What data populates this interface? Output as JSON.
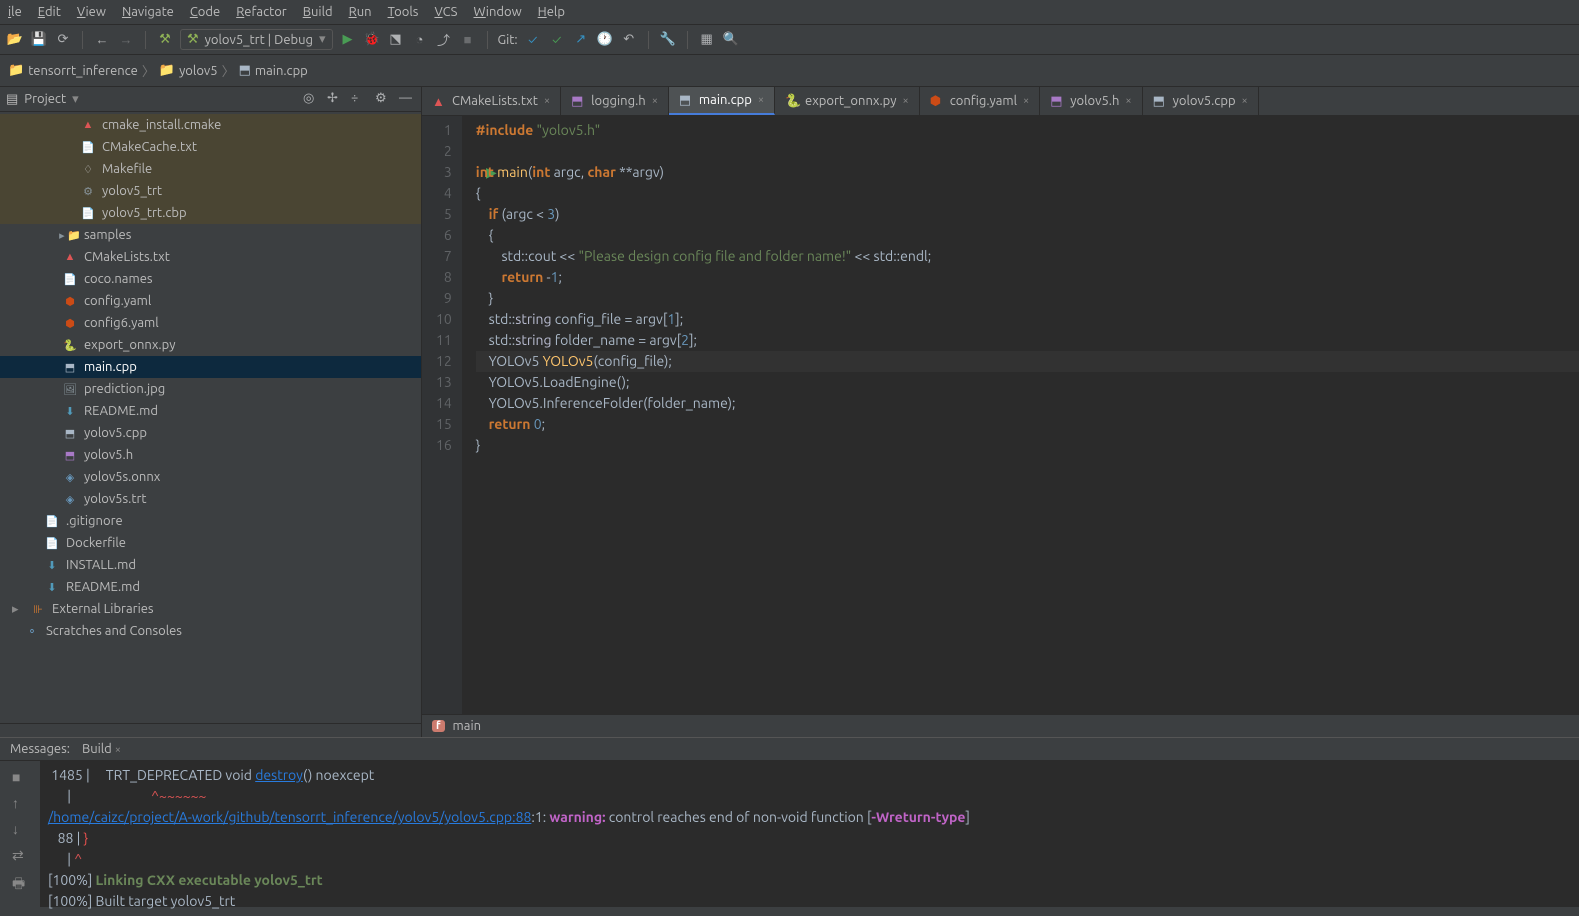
{
  "menu": [
    "ile",
    "Edit",
    "View",
    "Navigate",
    "Code",
    "Refactor",
    "Build",
    "Run",
    "Tools",
    "VCS",
    "Window",
    "Help"
  ],
  "toolbar": {
    "run_config": "yolov5_trt | Debug",
    "git_label": "Git:"
  },
  "breadcrumb": {
    "root": "tensorrt_inference",
    "folder": "yolov5",
    "file": "main.cpp"
  },
  "project": {
    "label": "Project",
    "items": [
      {
        "name": "cmake_install.cmake",
        "cls": "fi-cmake",
        "icon": "▲",
        "i": 3,
        "hl": true
      },
      {
        "name": "CMakeCache.txt",
        "cls": "fi-txt",
        "icon": "📄",
        "i": 3,
        "hl": true
      },
      {
        "name": "Makefile",
        "cls": "fi-make",
        "icon": "♢",
        "i": 3,
        "hl": true
      },
      {
        "name": "yolov5_trt",
        "cls": "fi-txt",
        "icon": "⚙",
        "i": 3,
        "hl": true
      },
      {
        "name": "yolov5_trt.cbp",
        "cls": "fi-txt",
        "icon": "📄",
        "i": 3,
        "hl": true
      },
      {
        "name": "samples",
        "cls": "fi-folder",
        "icon": "▸ 📁",
        "i": 2
      },
      {
        "name": "CMakeLists.txt",
        "cls": "fi-cmake",
        "icon": "▲",
        "i": 2
      },
      {
        "name": "coco.names",
        "cls": "fi-txt",
        "icon": "📄",
        "i": 2
      },
      {
        "name": "config.yaml",
        "cls": "fi-yaml",
        "icon": "⬢",
        "i": 2
      },
      {
        "name": "config6.yaml",
        "cls": "fi-yaml",
        "icon": "⬢",
        "i": 2
      },
      {
        "name": "export_onnx.py",
        "cls": "fi-py",
        "icon": "🐍",
        "i": 2
      },
      {
        "name": "main.cpp",
        "cls": "fi-cpp",
        "icon": "⬒",
        "i": 2,
        "sel": true
      },
      {
        "name": "prediction.jpg",
        "cls": "fi-txt",
        "icon": "🖼",
        "i": 2
      },
      {
        "name": "README.md",
        "cls": "fi-md",
        "icon": "⬇",
        "i": 2
      },
      {
        "name": "yolov5.cpp",
        "cls": "fi-cpp",
        "icon": "⬒",
        "i": 2
      },
      {
        "name": "yolov5.h",
        "cls": "fi-h",
        "icon": "⬒",
        "i": 2
      },
      {
        "name": "yolov5s.onnx",
        "cls": "fi-onnx",
        "icon": "◈",
        "i": 2
      },
      {
        "name": "yolov5s.trt",
        "cls": "fi-onnx",
        "icon": "◈",
        "i": 2
      },
      {
        "name": ".gitignore",
        "cls": "fi-txt",
        "icon": "📄",
        "i": 1
      },
      {
        "name": "Dockerfile",
        "cls": "fi-txt",
        "icon": "📄",
        "i": 1
      },
      {
        "name": "INSTALL.md",
        "cls": "fi-md",
        "icon": "⬇",
        "i": 1
      },
      {
        "name": "README.md",
        "cls": "fi-md",
        "icon": "⬇",
        "i": 1
      }
    ],
    "ext_lib": "External Libraries",
    "scratches": "Scratches and Consoles"
  },
  "tabs": [
    {
      "name": "CMakeLists.txt",
      "icon": "▲",
      "cls": "fi-cmake"
    },
    {
      "name": "logging.h",
      "icon": "⬒",
      "cls": "fi-h"
    },
    {
      "name": "main.cpp",
      "icon": "⬒",
      "cls": "fi-cpp",
      "active": true
    },
    {
      "name": "export_onnx.py",
      "icon": "🐍",
      "cls": "fi-py"
    },
    {
      "name": "config.yaml",
      "icon": "⬢",
      "cls": "fi-yaml"
    },
    {
      "name": "yolov5.h",
      "icon": "⬒",
      "cls": "fi-h"
    },
    {
      "name": "yolov5.cpp",
      "icon": "⬒",
      "cls": "fi-cpp"
    }
  ],
  "code": {
    "lines": [
      {
        "n": 1,
        "html": "<span class='kw'>#include</span> <span class='str'>\"yolov5.h\"</span>"
      },
      {
        "n": 2,
        "html": ""
      },
      {
        "n": 3,
        "html": "<span class='kw'>int</span> <span class='fn'>main</span>(<span class='kw'>int</span> argc, <span class='kw'>char</span> **argv)",
        "run": true
      },
      {
        "n": 4,
        "html": "{"
      },
      {
        "n": 5,
        "html": "    <span class='kw'>if</span> (argc < <span class='num'>3</span>)"
      },
      {
        "n": 6,
        "html": "    {"
      },
      {
        "n": 7,
        "html": "        std::cout << <span class='str'>\"Please design config file and folder name!\"</span> << std::endl;"
      },
      {
        "n": 8,
        "html": "        <span class='kw'>return</span> -<span class='num'>1</span>;"
      },
      {
        "n": 9,
        "html": "    }"
      },
      {
        "n": 10,
        "html": "    std::<span class='typ'>string</span> config_file = argv[<span class='num'>1</span>];"
      },
      {
        "n": 11,
        "html": "    std::<span class='typ'>string</span> folder_name = argv[<span class='num'>2</span>];"
      },
      {
        "n": 12,
        "html": "    YOLOv5 <span class='fn'>YOLOv5</span>(config_file);",
        "cur": true
      },
      {
        "n": 13,
        "html": "    YOLOv5.LoadEngine();"
      },
      {
        "n": 14,
        "html": "    YOLOv5.InferenceFolder(folder_name);"
      },
      {
        "n": 15,
        "html": "    <span class='kw'>return</span> <span class='num'>0</span>;"
      },
      {
        "n": 16,
        "html": "}"
      }
    ]
  },
  "breadcrumb_bottom": {
    "fn": "main"
  },
  "messages": {
    "label": "Messages:",
    "tab": "Build",
    "lines": [
      " 1485 |     TRT_DEPRECATED void <span class='link'>destroy</span>() noexcept",
      "      |                         <span class='errctx'>^~~~~~~</span>",
      "<span class='link'>/home/caizc/project/A-work/github/tensorrt_inference/yolov5/yolov5.cpp:88</span>:1: <span class='mag'>warning:</span> control reaches end of non-void function [<span class='mag'>-Wreturn-type</span>]",
      "   88 | <span class='err'>}</span>",
      "      | <span class='errctx'>^</span>",
      "[100%] <span class='ok'>Linking CXX executable yolov5_trt</span>",
      "[100%] Built target yolov5_trt"
    ]
  }
}
